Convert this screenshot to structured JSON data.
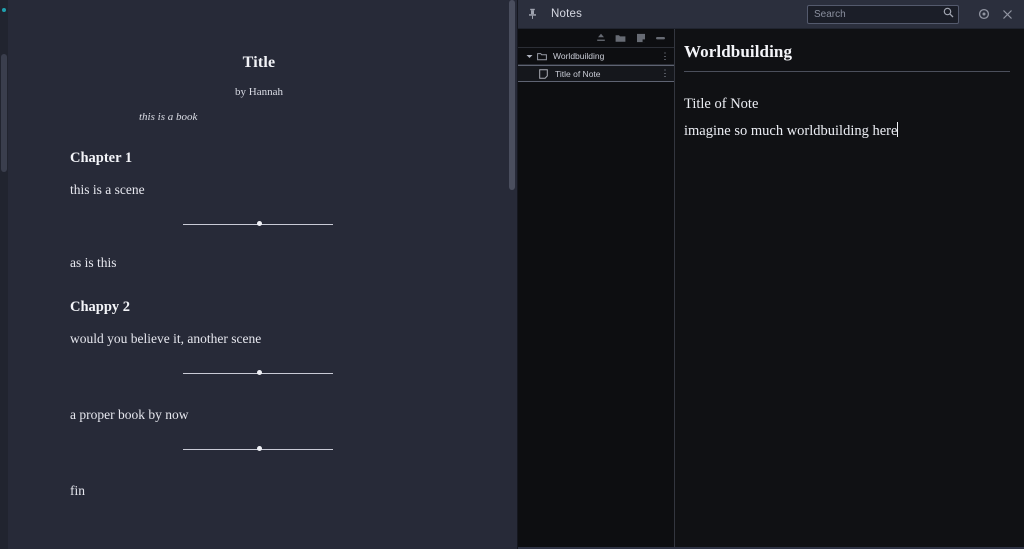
{
  "manuscript": {
    "title": "Title",
    "byline": "by Hannah",
    "tagline": "this is a book",
    "blocks": [
      {
        "kind": "chapter",
        "text": "Chapter 1"
      },
      {
        "kind": "para",
        "text": "this is a scene"
      },
      {
        "kind": "scene-break",
        "text": ""
      },
      {
        "kind": "para",
        "text": "as is this"
      },
      {
        "kind": "chapter",
        "text": "Chappy 2"
      },
      {
        "kind": "para",
        "text": "would you believe it, another scene"
      },
      {
        "kind": "scene-break",
        "text": ""
      },
      {
        "kind": "para",
        "text": "a proper book by now"
      },
      {
        "kind": "scene-break",
        "text": ""
      },
      {
        "kind": "para",
        "text": "fin"
      }
    ]
  },
  "notes": {
    "window_title": "Notes",
    "pin_icon": "pin-icon",
    "search": {
      "placeholder": "Search",
      "value": "",
      "icon": "magnifier-icon"
    },
    "settings_icon": "gear-icon",
    "close_icon": "close-icon",
    "toolbar": [
      {
        "icon": "import-icon",
        "label": "Import"
      },
      {
        "icon": "new-folder-icon",
        "label": "New Folder"
      },
      {
        "icon": "new-note-icon",
        "label": "New Note"
      },
      {
        "icon": "more-icon",
        "label": "More"
      }
    ],
    "tree": [
      {
        "label": "Worldbuilding",
        "icon": "folder-icon",
        "caret": "chevron-down-icon",
        "depth": 0,
        "selected": false,
        "more": "⋮"
      },
      {
        "label": "Title of Note",
        "icon": "note-icon",
        "caret": "",
        "depth": 1,
        "selected": true,
        "more": "⋮"
      }
    ],
    "content": {
      "heading": "Worldbuilding",
      "line1": "Title of Note",
      "line2": "imagine so much worldbuilding here"
    }
  },
  "colors": {
    "manuscript_bg": "#272a38",
    "notes_bg": "#101114",
    "notes_header_bg": "#2b2f3d",
    "accent": "#1fb6c4",
    "text": "#eceef4"
  }
}
